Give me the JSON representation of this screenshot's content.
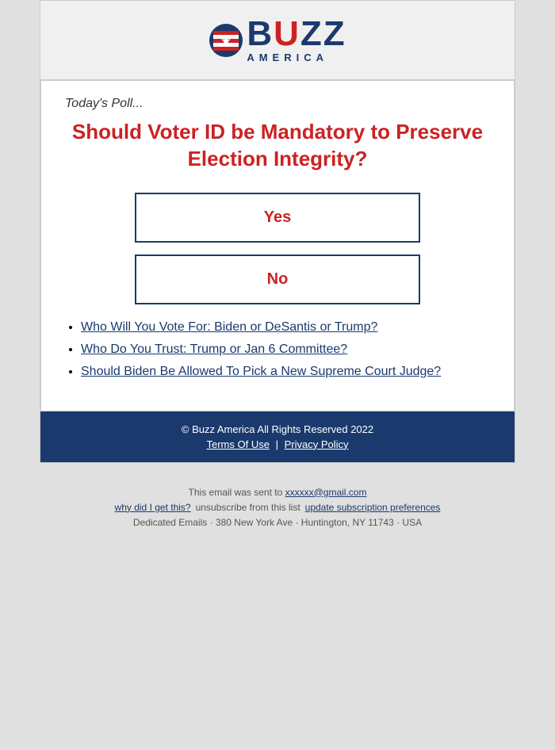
{
  "header": {
    "logo_buzz": "B",
    "logo_buzz_u": "U",
    "logo_buzz_zz": "ZZ",
    "logo_america": "AMERICA"
  },
  "poll": {
    "today_label": "Today's Poll...",
    "question": "Should Voter ID be Mandatory to Preserve Election Integrity?",
    "yes_label": "Yes",
    "no_label": "No"
  },
  "related_polls": [
    {
      "text": "Who Will You Vote For: Biden or DeSantis or Trump?",
      "href": "#"
    },
    {
      "text": "Who Do You Trust: Trump or Jan 6 Committee?",
      "href": "#"
    },
    {
      "text": "Should Biden Be Allowed To Pick a New Supreme Court Judge?",
      "href": "#"
    }
  ],
  "footer": {
    "copyright": "© Buzz America All Rights Reserved 2022",
    "terms_label": "Terms Of Use",
    "terms_href": "#",
    "separator": "|",
    "privacy_label": "Privacy Policy",
    "privacy_href": "#"
  },
  "bottom": {
    "email_line": "This email was sent to",
    "email_address": "xxxxxx@gmail.com",
    "why_label": "why did I get this?",
    "unsubscribe_label": "unsubscribe from this list",
    "preferences_label": "update subscription preferences",
    "address": "Dedicated Emails · 380 New York Ave · Huntington, NY 11743 · USA"
  }
}
